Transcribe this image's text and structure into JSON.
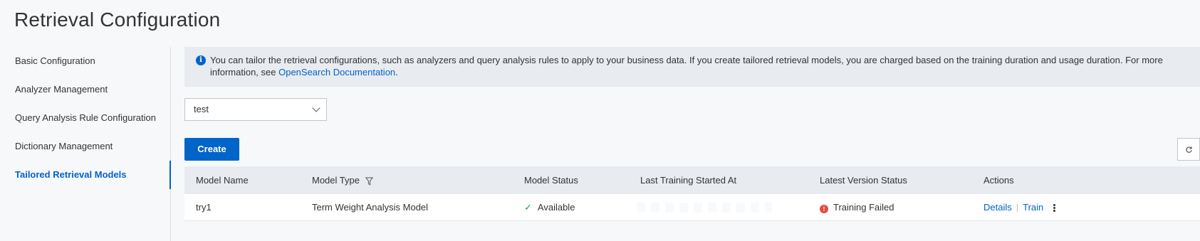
{
  "page": {
    "title": "Retrieval Configuration"
  },
  "sidebar": {
    "items": [
      {
        "label": "Basic Configuration",
        "active": false
      },
      {
        "label": "Analyzer Management",
        "active": false
      },
      {
        "label": "Query Analysis Rule Configuration",
        "active": false
      },
      {
        "label": "Dictionary Management",
        "active": false
      },
      {
        "label": "Tailored Retrieval Models",
        "active": true
      }
    ]
  },
  "notice": {
    "icon": "info-icon",
    "text": "You can tailor the retrieval configurations, such as analyzers and query analysis rules to apply to your business data. If you create tailored retrieval models, you are charged based on the training duration and usage duration. For more information, see ",
    "link": "OpenSearch Documentation",
    "suffix": "."
  },
  "selector": {
    "value": "test"
  },
  "toolbar": {
    "create_label": "Create",
    "refresh_icon": "refresh-icon"
  },
  "table": {
    "headers": {
      "name": "Model Name",
      "type": "Model Type",
      "status": "Model Status",
      "last_training": "Last Training Started At",
      "latest_version_status": "Latest Version Status",
      "actions": "Actions"
    },
    "rows": [
      {
        "name": "try1",
        "type": "Term Weight Analysis Model",
        "status": "Available",
        "last_training": "",
        "latest_version_status": "Training Failed",
        "actions": {
          "details": "Details",
          "train": "Train"
        }
      }
    ]
  },
  "colors": {
    "accent": "#0064c8",
    "success": "#1ea24e",
    "error": "#e04b41",
    "banner": "#e8ebf0"
  }
}
